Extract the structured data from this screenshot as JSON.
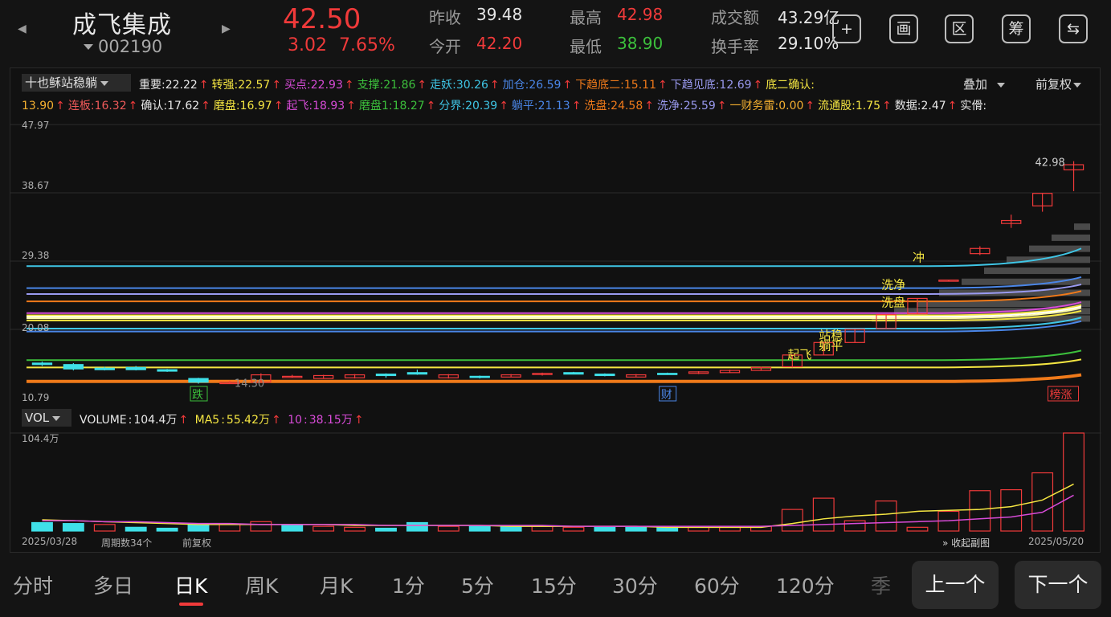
{
  "header": {
    "name": "成飞集成",
    "code": "002190",
    "price": "42.50",
    "change": "3.02",
    "change_pct": "7.65%",
    "prev_close_label": "昨收",
    "prev_close": "39.48",
    "open_label": "今开",
    "open": "42.20",
    "high_label": "最高",
    "high": "42.98",
    "low_label": "最低",
    "low": "38.90",
    "amount_label": "成交额",
    "amount": "43.29亿",
    "turnover_label": "换手率",
    "turnover": "29.10%",
    "icons": [
      "add-icon",
      "drawing-icon",
      "range-icon",
      "chip-icon",
      "switch-icon"
    ],
    "icon_glyphs": [
      "+",
      "画",
      "区",
      "筹",
      "⇆"
    ]
  },
  "indicator": {
    "name": "十也稣站稳躺",
    "overlay": "叠加",
    "adjust": "前复权",
    "items_row1": [
      {
        "label": "重要",
        "value": "22.22",
        "color": "#e8e8e8"
      },
      {
        "label": "转强",
        "value": "22.57",
        "color": "#f5e642"
      },
      {
        "label": "买点",
        "value": "22.93",
        "color": "#d84bd8"
      },
      {
        "label": "支撑",
        "value": "21.86",
        "color": "#3cc03c"
      },
      {
        "label": "走妖",
        "value": "30.26",
        "color": "#3fc6e6"
      },
      {
        "label": "加仓",
        "value": "26.59",
        "color": "#4a86e8"
      },
      {
        "label": "下趋底二",
        "value": "15.11",
        "color": "#f07a1a"
      },
      {
        "label": "下趋见底",
        "value": "12.69",
        "color": "#9a9af0"
      },
      {
        "label": "底二确认",
        "value": "",
        "color": "#f5e642"
      }
    ],
    "items_row2": [
      {
        "label": "",
        "value": "13.90",
        "color": "#f5b030"
      },
      {
        "label": "连板",
        "value": "16.32",
        "color": "#f05a5a"
      },
      {
        "label": "确认",
        "value": "17.62",
        "color": "#e8e8e8"
      },
      {
        "label": "磨盘",
        "value": "16.97",
        "color": "#f5e642"
      },
      {
        "label": "起飞",
        "value": "18.93",
        "color": "#d84bd8"
      },
      {
        "label": "磨盘1",
        "value": "18.27",
        "color": "#3cc03c"
      },
      {
        "label": "分界",
        "value": "20.39",
        "color": "#3fc6e6"
      },
      {
        "label": "躺平",
        "value": "21.13",
        "color": "#4a86e8"
      },
      {
        "label": "洗盘",
        "value": "24.58",
        "color": "#f07a1a"
      },
      {
        "label": "洗净",
        "value": "25.59",
        "color": "#9a9af0"
      },
      {
        "label": "一财务雷",
        "value": "0.00",
        "color": "#f5b030"
      },
      {
        "label": "流通股",
        "value": "1.75",
        "color": "#f5e642"
      },
      {
        "label": "数据",
        "value": "2.47",
        "color": "#e8e8e8"
      },
      {
        "label": "实傦",
        "value": "",
        "color": "#e8e8e8"
      }
    ]
  },
  "chart_data": [
    {
      "type": "candlestick",
      "y_ticks": [
        "47.97",
        "38.67",
        "29.38",
        "20.08",
        "10.79"
      ],
      "ylim": [
        10.79,
        47.97
      ],
      "candles": [
        {
          "o": 15.5,
          "c": 15.3,
          "h": 15.7,
          "l": 15.1
        },
        {
          "o": 15.3,
          "c": 14.7,
          "h": 15.5,
          "l": 14.5
        },
        {
          "o": 14.8,
          "c": 14.6,
          "h": 15.0,
          "l": 14.5
        },
        {
          "o": 14.9,
          "c": 14.6,
          "h": 15.1,
          "l": 14.5
        },
        {
          "o": 14.6,
          "c": 14.4,
          "h": 14.7,
          "l": 14.3
        },
        {
          "o": 13.4,
          "c": 12.9,
          "h": 13.5,
          "l": 12.7
        },
        {
          "o": 12.7,
          "c": 12.9,
          "h": 13.1,
          "l": 12.7
        },
        {
          "o": 12.9,
          "c": 13.9,
          "h": 14.1,
          "l": 12.9
        },
        {
          "o": 13.6,
          "c": 13.7,
          "h": 13.9,
          "l": 13.5
        },
        {
          "o": 13.4,
          "c": 13.8,
          "h": 13.9,
          "l": 13.4
        },
        {
          "o": 13.5,
          "c": 13.9,
          "h": 14.0,
          "l": 13.4
        },
        {
          "o": 14.0,
          "c": 13.8,
          "h": 14.1,
          "l": 13.5
        },
        {
          "o": 14.2,
          "c": 14.0,
          "h": 14.6,
          "l": 13.9
        },
        {
          "o": 13.5,
          "c": 13.9,
          "h": 14.0,
          "l": 13.4
        },
        {
          "o": 13.7,
          "c": 13.6,
          "h": 13.8,
          "l": 13.4
        },
        {
          "o": 13.6,
          "c": 13.9,
          "h": 14.0,
          "l": 13.6
        },
        {
          "o": 14.0,
          "c": 14.1,
          "h": 14.2,
          "l": 13.8
        },
        {
          "o": 14.2,
          "c": 14.0,
          "h": 14.3,
          "l": 14.0
        },
        {
          "o": 14.0,
          "c": 13.8,
          "h": 14.1,
          "l": 13.7
        },
        {
          "o": 13.6,
          "c": 13.9,
          "h": 14.0,
          "l": 13.6
        },
        {
          "o": 14.1,
          "c": 14.0,
          "h": 14.2,
          "l": 13.9
        },
        {
          "o": 14.1,
          "c": 14.3,
          "h": 14.4,
          "l": 14.0
        },
        {
          "o": 14.2,
          "c": 14.5,
          "h": 14.6,
          "l": 14.2
        },
        {
          "o": 14.5,
          "c": 14.9,
          "h": 15.0,
          "l": 14.5
        },
        {
          "o": 15.0,
          "c": 16.6,
          "h": 16.6,
          "l": 14.9
        },
        {
          "o": 16.6,
          "c": 18.3,
          "h": 18.3,
          "l": 16.6
        },
        {
          "o": 18.3,
          "c": 20.1,
          "h": 20.1,
          "l": 18.3
        },
        {
          "o": 20.2,
          "c": 22.1,
          "h": 22.1,
          "l": 20.2
        },
        {
          "o": 22.2,
          "c": 24.3,
          "h": 24.3,
          "l": 22.2
        },
        {
          "o": 26.7,
          "c": 26.8,
          "h": 26.8,
          "l": 26.7
        },
        {
          "o": 30.4,
          "c": 31.1,
          "h": 31.4,
          "l": 30.2
        },
        {
          "o": 34.5,
          "c": 34.9,
          "h": 35.7,
          "l": 33.9
        },
        {
          "o": 36.9,
          "c": 38.6,
          "h": 38.6,
          "l": 36.1
        },
        {
          "o": 41.8,
          "c": 42.5,
          "h": 42.98,
          "l": 38.9
        }
      ],
      "candle_colors": {
        "up": "#f03a3a",
        "down": "#3fe0e8"
      },
      "annotations": [
        {
          "text": "42.98",
          "color": "#cfcfcf"
        },
        {
          "text": "14.30",
          "color": "#8a8a8a"
        },
        {
          "text": "冲",
          "color": "#f5e642"
        },
        {
          "text": "洗净",
          "color": "#f5e642"
        },
        {
          "text": "洗盘",
          "color": "#f5e642"
        },
        {
          "text": "站稳",
          "color": "#f5e642"
        },
        {
          "text": "躺平",
          "color": "#f5e642"
        },
        {
          "text": "起飞",
          "color": "#f5e642"
        }
      ],
      "badges": [
        {
          "text": "跌",
          "color": "#3cc03c"
        },
        {
          "text": "财",
          "color": "#4a86e8"
        },
        {
          "text": "榜涨",
          "color": "#f03a3a"
        }
      ]
    },
    {
      "type": "bar",
      "title": "VOL",
      "volume_label": "VOLUME",
      "volume": "104.4万",
      "ma5_label": "MA5",
      "ma5": "55.42万",
      "ma10_label": "10",
      "ma10": "38.15万",
      "y_max_label": "104.4万",
      "values": [
        9,
        8,
        7,
        4,
        3,
        7,
        7,
        10,
        6,
        5,
        4,
        3,
        9,
        5,
        5,
        5,
        5,
        4,
        4,
        4,
        4,
        4,
        4,
        5,
        23,
        35,
        11,
        32,
        4,
        21,
        43,
        44,
        62,
        104.4
      ],
      "directions": [
        "d",
        "d",
        "u",
        "d",
        "d",
        "d",
        "u",
        "u",
        "d",
        "u",
        "u",
        "d",
        "d",
        "u",
        "d",
        "d",
        "u",
        "u",
        "d",
        "d",
        "d",
        "u",
        "u",
        "u",
        "u",
        "u",
        "u",
        "u",
        "u",
        "u",
        "u",
        "u",
        "u",
        "u"
      ],
      "ma5_values": [
        12,
        11,
        10,
        9,
        8,
        7,
        7,
        7,
        7,
        7,
        6,
        6,
        6,
        6,
        6,
        5,
        5,
        5,
        5,
        5,
        4,
        4,
        4,
        4,
        8,
        13,
        16,
        18,
        21,
        22,
        23,
        26,
        33,
        50
      ],
      "ma10_values": [
        11,
        11,
        10,
        10,
        9,
        8,
        8,
        7,
        7,
        7,
        7,
        6,
        6,
        6,
        6,
        6,
        6,
        5,
        5,
        5,
        5,
        5,
        5,
        5,
        6,
        7,
        8,
        9,
        10,
        11,
        13,
        15,
        20,
        38.15
      ],
      "start_date": "2025/03/28",
      "end_date": "2025/05/20",
      "period_count": "周期数34个",
      "adjust": "前复权",
      "collapse": "收起副图"
    }
  ],
  "tabs": [
    "分时",
    "多日",
    "日K",
    "周K",
    "月K",
    "1分",
    "5分",
    "15分",
    "30分",
    "60分",
    "120分",
    "季"
  ],
  "active_tab": "日K",
  "nav": {
    "prev": "上一个",
    "next": "下一个"
  }
}
